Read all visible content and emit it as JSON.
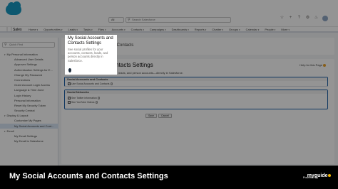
{
  "header": {
    "app_logo_name": "salesforce-cloud-logo",
    "logo_color": "#1798c1",
    "search_scope": "All",
    "search_placeholder": "Search Salesforce",
    "icons": [
      "star-icon",
      "add-icon",
      "help-icon",
      "gear-icon",
      "bell-icon"
    ]
  },
  "nav": {
    "app_name": "Sales",
    "items": [
      "Home",
      "Opportunities",
      "Leads",
      "Tasks",
      "Files",
      "Accounts",
      "Contacts",
      "Campaigns",
      "Dashboards",
      "Reports",
      "Chatter",
      "Groups",
      "Calendar",
      "People",
      "More"
    ]
  },
  "sidebar": {
    "quick_find_placeholder": "Quick Find",
    "tree": [
      {
        "label": "My Personal Information",
        "type": "group"
      },
      {
        "label": "Advanced User Details",
        "type": "item"
      },
      {
        "label": "Approver Settings",
        "type": "item"
      },
      {
        "label": "Authentication Settings for E...",
        "type": "item"
      },
      {
        "label": "Change My Password",
        "type": "item"
      },
      {
        "label": "Connections",
        "type": "item"
      },
      {
        "label": "Grant Account Login Access",
        "type": "item"
      },
      {
        "label": "Language & Time Zone",
        "type": "item"
      },
      {
        "label": "Login History",
        "type": "item"
      },
      {
        "label": "Personal Information",
        "type": "item"
      },
      {
        "label": "Reset My Security Token",
        "type": "item"
      },
      {
        "label": "Security Central",
        "type": "item"
      },
      {
        "label": "Display & Layout",
        "type": "group"
      },
      {
        "label": "Customize My Pages",
        "type": "item"
      },
      {
        "label": "My Social Accounts and Cont...",
        "type": "item",
        "selected": true
      },
      {
        "label": "Email",
        "type": "group"
      },
      {
        "label": "My Email Settings",
        "type": "item"
      },
      {
        "label": "My Email to Salesforce",
        "type": "item"
      }
    ]
  },
  "main": {
    "header_title": "and Contacts",
    "title": "Contacts Settings",
    "help_link": "Help for this Page",
    "description": "leads, and person accounts—directly in Salesforce.",
    "section1_title": "Social Accounts and Contacts",
    "section1_check": "Use Social Accounts and Contacts",
    "section2_title": "Social Networks",
    "section2_checks": [
      "See Twitter information",
      "See YouTube Videos"
    ],
    "save_label": "Save",
    "cancel_label": "Cancel"
  },
  "tooltip": {
    "title": "My Social Accounts and Contacts Settings",
    "body": "See social profiles for your accounts, contacts, leads, and person accounts directly in Salesforce."
  },
  "banner": {
    "title": "My Social Accounts and Contacts Settings",
    "powered_by": "Powered by",
    "brand": "myguide",
    "brand_accent": "#f5b700"
  }
}
